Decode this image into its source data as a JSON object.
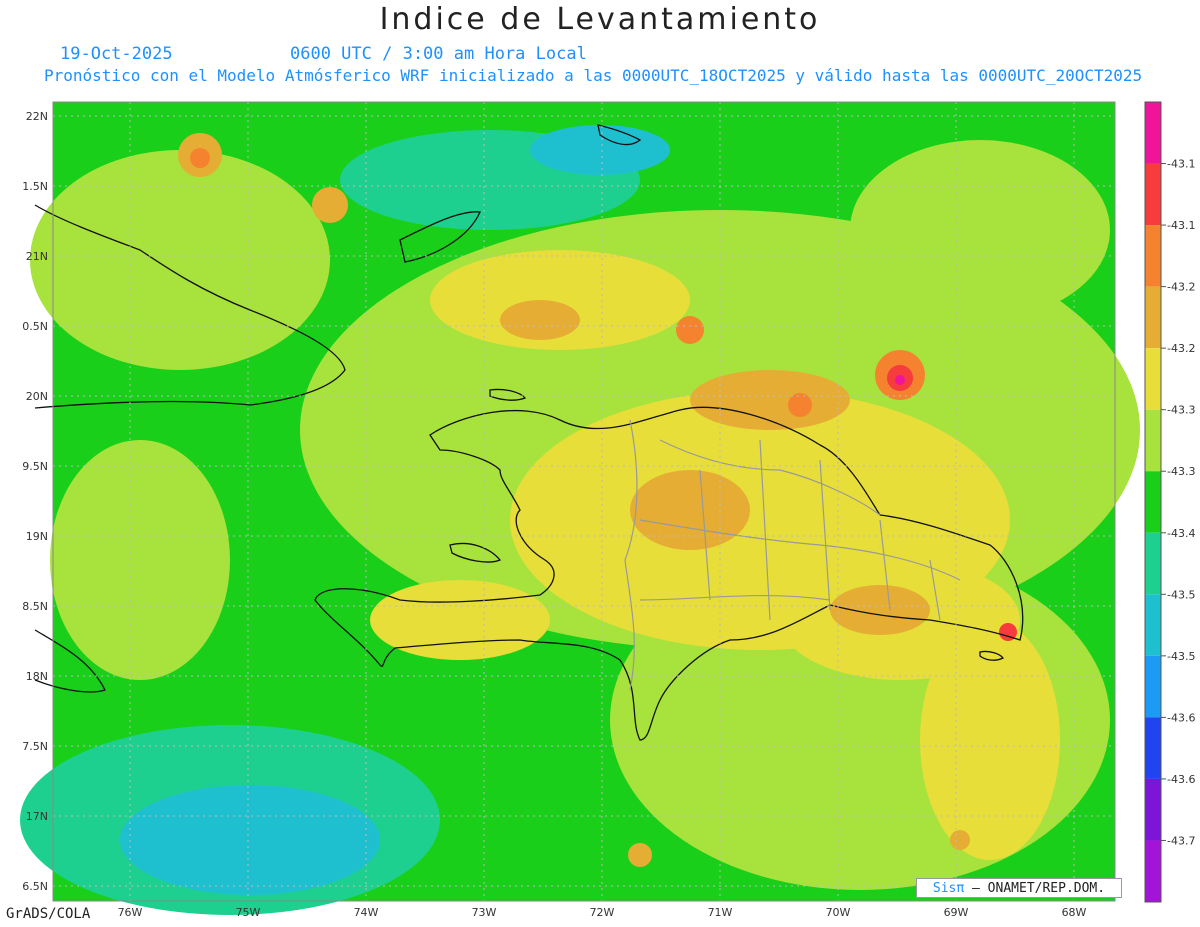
{
  "header": {
    "title": "Indice de Levantamiento",
    "date": "19-Oct-2025",
    "time": "0600 UTC / 3:00 am Hora Local",
    "description": "Pronóstico con el Modelo Atmósferico WRF inicializado a las 0000UTC_18OCT2025 y válido hasta las  0000UTC_20OCT2025"
  },
  "axes": {
    "lat_labels": [
      "22N",
      "1.5N",
      "21N",
      "0.5N",
      "20N",
      "9.5N",
      "19N",
      "8.5N",
      "18N",
      "7.5N",
      "17N",
      "6.5N"
    ],
    "lon_labels": [
      "76W",
      "75W",
      "74W",
      "73W",
      "72W",
      "71W",
      "70W",
      "69W",
      "68W"
    ]
  },
  "colorbar": {
    "labels": [
      "-43.1",
      "-43.1",
      "-43.2",
      "-43.2",
      "-43.3",
      "-43.3",
      "-43.4",
      "-43.5",
      "-43.5",
      "-43.6",
      "-43.6",
      "-43.7"
    ],
    "colors": [
      "#f0149b",
      "#f63c3c",
      "#f5822f",
      "#e6ad35",
      "#e8de3a",
      "#a8e23c",
      "#19cf19",
      "#1ed08f",
      "#1ec0d0",
      "#1c9bf5",
      "#1f44f0",
      "#7c15d8",
      "#a414d8"
    ]
  },
  "footer": {
    "software": "GrADS/COLA",
    "credit_brand": "Sisπ",
    "credit_text": "– ONAMET/REP.DOM."
  },
  "map_colors": {
    "ocean_deep": "#1ed08f",
    "ocean": "#19cf19",
    "low": "#a8e23c",
    "mid": "#e8de3a",
    "high": "#e6ad35",
    "hot": "#f5822f",
    "hotter": "#f63c3c",
    "peak": "#f0149b",
    "cool": "#1ec0d0"
  }
}
